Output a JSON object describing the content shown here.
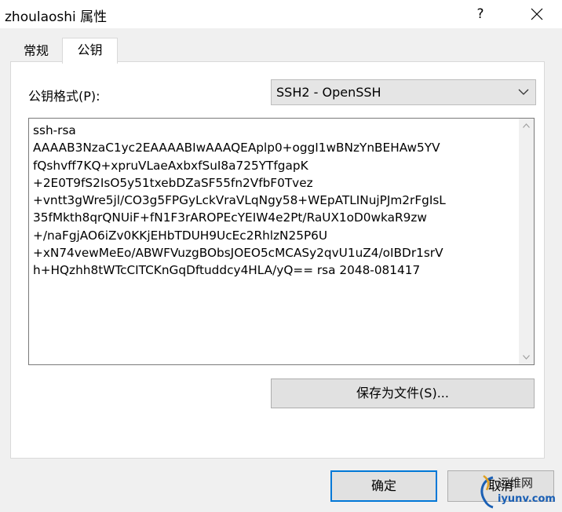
{
  "window": {
    "title": "zhoulaoshi 属性",
    "help_label": "?"
  },
  "tabs": [
    {
      "label": "常规",
      "selected": false
    },
    {
      "label": "公钥",
      "selected": true
    }
  ],
  "key_format": {
    "label": "公钥格式(P):",
    "selected": "SSH2 - OpenSSH"
  },
  "public_key": {
    "lines": [
      "ssh-rsa",
      "AAAAB3NzaC1yc2EAAAABIwAAAQEAplp0+oggI1wBNzYnBEHAw5YV",
      "fQshvff7KQ+xpruVLaeAxbxfSuI8a725YTfgapK",
      "+2E0T9fS2IsO5y51txebDZaSF55fn2VfbF0Tvez",
      "+vntt3gWre5jl/CO3g5FPGyLckVraVLqNgy58+WEpATLINujPJm2rFgIsL",
      "35fMkth8qrQNUiF+fN1F3rAROPEcYEIW4e2Pt/RaUX1oD0wkaR9zw",
      "+/naFgjAO6iZv0KKjEHbTDUH9UcEc2RhlzN25P6U",
      "+xN74vewMeEo/ABWFVuzgBObsJOEO5cMCASy2qvU1uZ4/oIBDr1srV",
      "h+HQzhh8tWTcCITCKnGqDftuddcy4HLA/yQ== rsa 2048-081417"
    ]
  },
  "buttons": {
    "save": "保存为文件(S)...",
    "ok": "确定",
    "cancel": "取消"
  },
  "watermark": {
    "top": "运维网",
    "bottom": "iyunv.com"
  }
}
